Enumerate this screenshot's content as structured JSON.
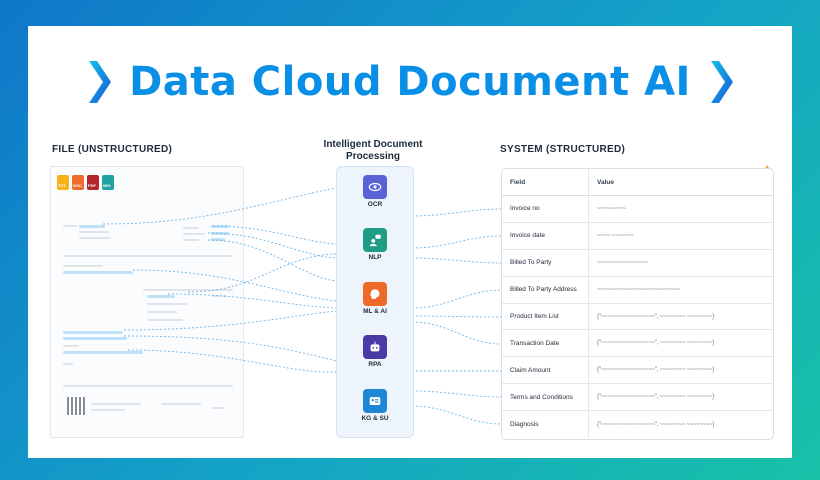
{
  "title": "Data Cloud Document AI",
  "left_section": "FILE  (UNSTRUCTURED)",
  "middle_section": "Intelligent Document Processing",
  "right_section": "SYSTEM  (STRUCTURED)",
  "file_types": [
    {
      "label": "TXT",
      "color": "#f5b21a"
    },
    {
      "label": "DOC",
      "color": "#f06a2a"
    },
    {
      "label": "PDF",
      "color": "#b5252c"
    },
    {
      "label": "IMG",
      "color": "#1fa2a0"
    }
  ],
  "steps": [
    {
      "label": "OCR",
      "icon": "eye-icon",
      "color": "#5a63d6"
    },
    {
      "label": "NLP",
      "icon": "person-chat-icon",
      "color": "#1f9d84"
    },
    {
      "label": "ML & AI",
      "icon": "brain-icon",
      "color": "#ef6a28"
    },
    {
      "label": "RPA",
      "icon": "robot-icon",
      "color": "#4a3aa8"
    },
    {
      "label": "KG & SU",
      "icon": "id-card-icon",
      "color": "#1f86d6"
    }
  ],
  "table": {
    "headers": {
      "field": "Field",
      "value": "Value"
    },
    "rows": [
      {
        "field": "Invoice no",
        "value": "~~~~~~~~~"
      },
      {
        "field": "Invoice date",
        "value": "~~~~   ~~~~~~~"
      },
      {
        "field": "Billed To Party",
        "value": "~~~~~~~~~~~~~~~~"
      },
      {
        "field": "Billed To Party Address",
        "value": "~~~~~~~~~~~~~~~~~~~~~~~~~~"
      },
      {
        "field": "Product Item List",
        "value": "{\"~~~~~~~~~~~~~~~~~\", ~~~~~~~~  ~~~~~~~~}"
      },
      {
        "field": "Transaction Date",
        "value": "{\"~~~~~~~~~~~~~~~~~\", ~~~~~~~~  ~~~~~~~~}"
      },
      {
        "field": "Claim Amount",
        "value": "{\"~~~~~~~~~~~~~~~~~\", ~~~~~~~~  ~~~~~~~~}"
      },
      {
        "field": "Terms and Conditions",
        "value": "{\"~~~~~~~~~~~~~~~~~\", ~~~~~~~~  ~~~~~~~~}"
      },
      {
        "field": "Diagnosis",
        "value": "{\"~~~~~~~~~~~~~~~~~\", ~~~~~~~~  ~~~~~~~~}"
      }
    ]
  }
}
